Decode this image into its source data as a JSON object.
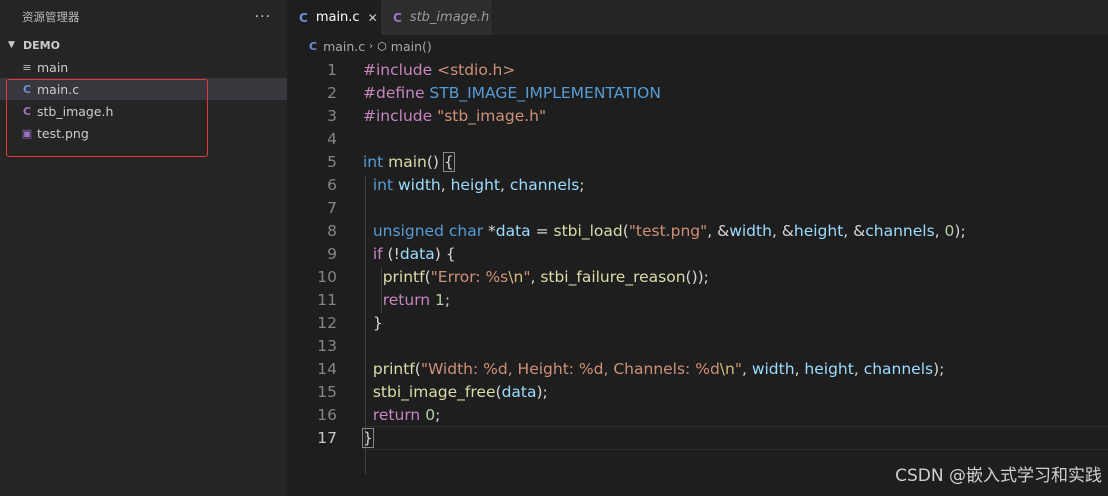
{
  "sidebar": {
    "title": "资源管理器",
    "more": "···",
    "section": "DEMO",
    "items": [
      {
        "label": "main",
        "icon": "≡"
      },
      {
        "label": "main.c",
        "icon": "C"
      },
      {
        "label": "stb_image.h",
        "icon": "C"
      },
      {
        "label": "test.png",
        "icon": "▣"
      }
    ]
  },
  "tabs": [
    {
      "label": "main.c",
      "icon": "C",
      "close": "✕"
    },
    {
      "label": "stb_image.h",
      "icon": "C"
    }
  ],
  "breadcrumb": {
    "file": "main.c",
    "icon": "C",
    "sep": "›",
    "symbol": "main()",
    "symbol_icon": "⬡"
  },
  "lines": [
    "1",
    "2",
    "3",
    "4",
    "5",
    "6",
    "7",
    "8",
    "9",
    "10",
    "11",
    "12",
    "13",
    "14",
    "15",
    "16",
    "17"
  ],
  "code": {
    "l1": {
      "a": "#include ",
      "b": "<stdio.h>"
    },
    "l2": {
      "a": "#define ",
      "b": "STB_IMAGE_IMPLEMENTATION"
    },
    "l3": {
      "a": "#include ",
      "b": "\"stb_image.h\""
    },
    "l5": {
      "a": "int ",
      "b": "main",
      "c": "() ",
      "d": "{"
    },
    "l6": {
      "a": "  ",
      "b": "int ",
      "c": "width",
      "d": ", ",
      "e": "height",
      "f": ", ",
      "g": "channels",
      "h": ";"
    },
    "l8": {
      "a": "  ",
      "b": "unsigned ",
      "c": "char ",
      "d": "*",
      "e": "data",
      "f": " = ",
      "g": "stbi_load",
      "h": "(",
      "i": "\"test.png\"",
      "j": ", &",
      "k": "width",
      "l": ", &",
      "m": "height",
      "n": ", &",
      "o": "channels",
      "p": ", ",
      "q": "0",
      "r": ");"
    },
    "l9": {
      "a": "  ",
      "b": "if",
      "c": " (!",
      "d": "data",
      "e": ") {"
    },
    "l10": {
      "a": "    ",
      "b": "printf",
      "c": "(",
      "d": "\"Error: %s",
      "e": "\\n",
      "f": "\"",
      "g": ", ",
      "h": "stbi_failure_reason",
      "i": "());"
    },
    "l11": {
      "a": "    ",
      "b": "return ",
      "c": "1",
      "d": ";"
    },
    "l12": {
      "a": "  }"
    },
    "l14": {
      "a": "  ",
      "b": "printf",
      "c": "(",
      "d": "\"Width: %d, Height: %d, Channels: %d",
      "e": "\\n",
      "f": "\"",
      "g": ", ",
      "h": "width",
      "i": ", ",
      "j": "height",
      "k": ", ",
      "l": "channels",
      "m": ");"
    },
    "l15": {
      "a": "  ",
      "b": "stbi_image_free",
      "c": "(",
      "d": "data",
      "e": ");"
    },
    "l16": {
      "a": "  ",
      "b": "return ",
      "c": "0",
      "d": ";"
    },
    "l17": {
      "a": "}"
    }
  },
  "watermark": "CSDN @嵌入式学习和实践",
  "colors": {
    "accent_box": "#e03c3c",
    "c_icon": "#6d8fd8",
    "h_icon": "#a074c4"
  }
}
